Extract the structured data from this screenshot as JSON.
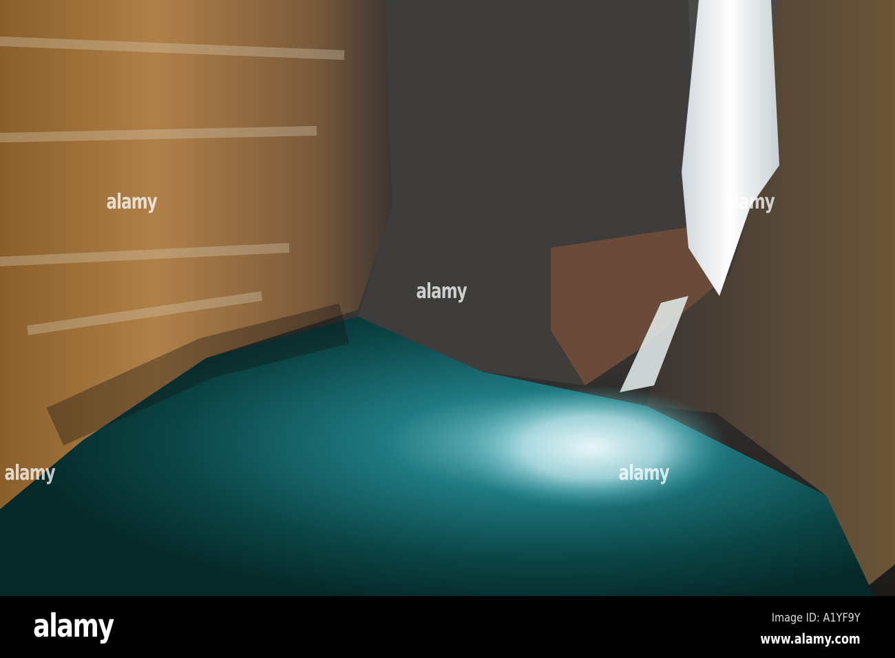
{
  "photo": {
    "subject": "waterfall-canyon-pool",
    "colors": {
      "rock_orange": "#9a6a2e",
      "rock_dark": "#3a3a3a",
      "water_teal": "#0d4a4a",
      "foam": "#cfe8ee"
    },
    "watermark_text": "alamy"
  },
  "footer": {
    "logo": "alamy",
    "image_id": "Image ID: A1YF9Y",
    "url": "www.alamy.com"
  }
}
